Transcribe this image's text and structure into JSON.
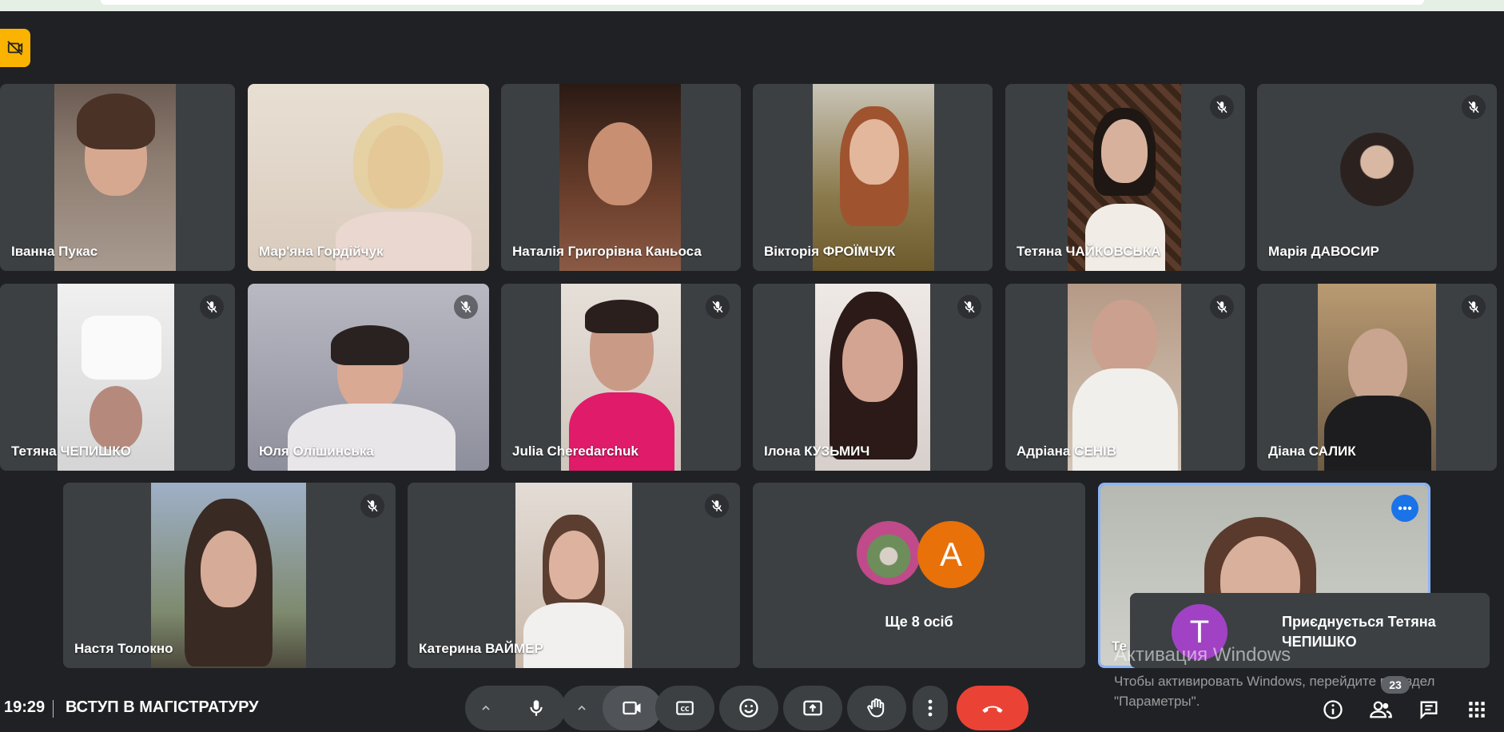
{
  "meeting": {
    "time": "19:29",
    "title": "ВСТУП В МАГІСТРАТУРУ"
  },
  "participants_row1": [
    {
      "name": "Іванна Пукас",
      "muted": false
    },
    {
      "name": "Мар'яна Гордійчук",
      "muted": false
    },
    {
      "name": "Наталія Григорівна Каньоса",
      "muted": false
    },
    {
      "name": "Вікторія ФРОЇМЧУК",
      "muted": false
    },
    {
      "name": "Тетяна ЧАЙКОВСЬКА",
      "muted": true
    },
    {
      "name": "Марія ДАВОСИР",
      "muted": true
    }
  ],
  "participants_row2": [
    {
      "name": "Тетяна ЧЕПИШКО",
      "muted": true
    },
    {
      "name": "Юля Олішинська",
      "muted": true
    },
    {
      "name": "Julia Cheredarchuk",
      "muted": true
    },
    {
      "name": "Ілона КУЗЬМИЧ",
      "muted": true
    },
    {
      "name": "Адріана СЕНІВ",
      "muted": true
    },
    {
      "name": "Діана САЛИК",
      "muted": true
    }
  ],
  "participants_row3": [
    {
      "name": "Настя Толокно",
      "muted": true
    },
    {
      "name": "Катерина ВАЙМЕР",
      "muted": true
    }
  ],
  "more_tile": {
    "avatar_letter": "A",
    "label": "Ще 8 осіб"
  },
  "active_tile": {
    "name_partial": "Те"
  },
  "toast": {
    "avatar_letter": "T",
    "text": "Приєднується Тетяна ЧЕПИШКО"
  },
  "windows_watermark": {
    "heading": "Активация Windows",
    "line": "Чтобы активировать Windows, перейдите в раздел \"Параметры\"."
  },
  "people_count": "23",
  "colors": {
    "background": "#202124",
    "tile": "#3c4043",
    "leave_button": "#ea4335",
    "active_border": "#8ab4f8",
    "recording_badge": "#f9b300"
  },
  "icons": [
    "recording-off-icon",
    "mic-off-icon",
    "more-options-icon",
    "chevron-up-icon",
    "mic-icon",
    "camera-icon",
    "captions-icon",
    "emoji-icon",
    "present-icon",
    "raise-hand-icon",
    "more-vert-icon",
    "call-end-icon",
    "info-icon",
    "people-icon",
    "chat-icon",
    "activities-icon"
  ]
}
